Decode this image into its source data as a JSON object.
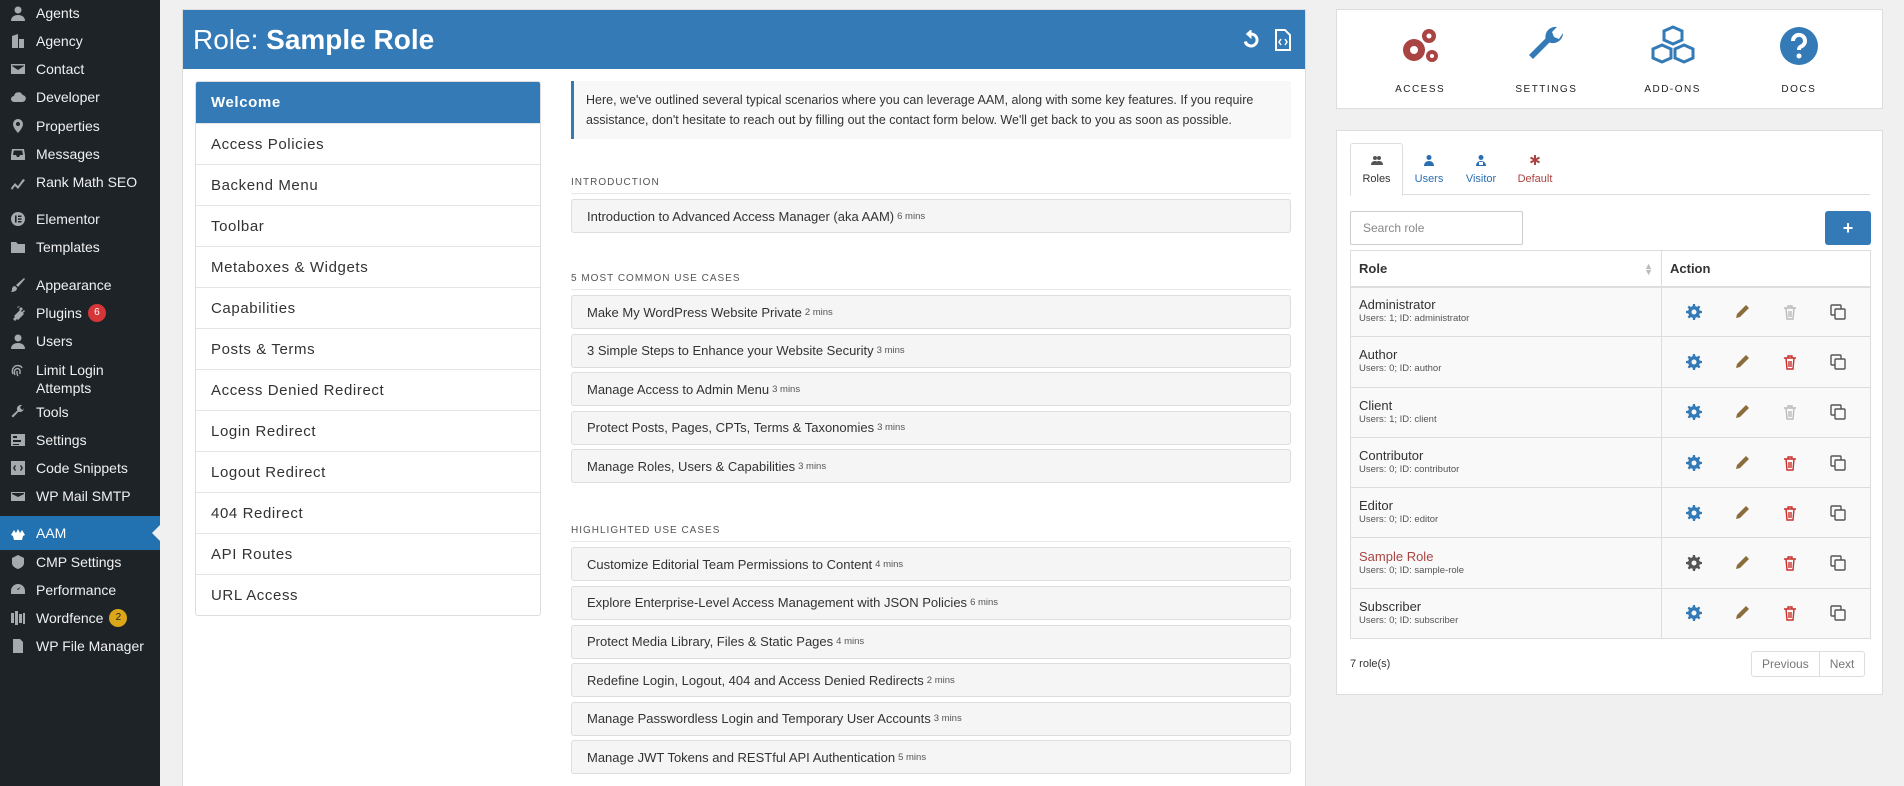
{
  "wp_menu": [
    {
      "label": "Agents",
      "icon": "user-icon"
    },
    {
      "label": "Agency",
      "icon": "building-icon"
    },
    {
      "label": "Contact",
      "icon": "mail-icon"
    },
    {
      "label": "Developer",
      "icon": "cloud-icon"
    },
    {
      "label": "Properties",
      "icon": "location-pin-icon"
    },
    {
      "label": "Messages",
      "icon": "inbox-icon"
    },
    {
      "label": "Rank Math SEO",
      "icon": "chart-icon"
    },
    {
      "label": "Elementor",
      "icon": "elementor-icon"
    },
    {
      "label": "Templates",
      "icon": "folder-icon"
    },
    {
      "label": "Appearance",
      "icon": "brush-icon"
    },
    {
      "label": "Plugins",
      "icon": "plug-icon",
      "badge": "6"
    },
    {
      "label": "Users",
      "icon": "users-icon"
    },
    {
      "label": "Limit Login Attempts",
      "icon": "fingerprint-icon"
    },
    {
      "label": "Tools",
      "icon": "wrench-icon"
    },
    {
      "label": "Settings",
      "icon": "sliders-icon"
    },
    {
      "label": "Code Snippets",
      "icon": "code-icon"
    },
    {
      "label": "WP Mail SMTP",
      "icon": "envelope-icon"
    },
    {
      "label": "AAM",
      "icon": "aam-icon",
      "active": true
    },
    {
      "label": "CMP Settings",
      "icon": "cmp-icon"
    },
    {
      "label": "Performance",
      "icon": "gauge-icon"
    },
    {
      "label": "Wordfence",
      "icon": "shield-icon",
      "badge": "2"
    },
    {
      "label": "WP File Manager",
      "icon": "file-icon"
    }
  ],
  "header": {
    "prefix": "Role:",
    "role_name": "Sample Role"
  },
  "nav": [
    "Welcome",
    "Access Policies",
    "Backend Menu",
    "Toolbar",
    "Metaboxes & Widgets",
    "Capabilities",
    "Posts & Terms",
    "Access Denied Redirect",
    "Login Redirect",
    "Logout Redirect",
    "404 Redirect",
    "API Routes",
    "URL Access"
  ],
  "intro_note": "Here, we've outlined several typical scenarios where you can leverage AAM, along with some key features. If you require assistance, don't hesitate to reach out by filling out the contact form below. We'll get back to you as soon as possible.",
  "sections": [
    {
      "title": "INTRODUCTION",
      "items": [
        {
          "label": "Introduction to Advanced Access Manager (aka AAM)",
          "mins": "6 mins"
        }
      ]
    },
    {
      "title": "5 MOST COMMON USE CASES",
      "items": [
        {
          "label": "Make My WordPress Website Private",
          "mins": "2 mins"
        },
        {
          "label": "3 Simple Steps to Enhance your Website Security",
          "mins": "3 mins"
        },
        {
          "label": "Manage Access to Admin Menu",
          "mins": "3 mins"
        },
        {
          "label": "Protect Posts, Pages, CPTs, Terms & Taxonomies",
          "mins": "3 mins"
        },
        {
          "label": "Manage Roles, Users & Capabilities",
          "mins": "3 mins"
        }
      ]
    },
    {
      "title": "HIGHLIGHTED USE CASES",
      "items": [
        {
          "label": "Customize Editorial Team Permissions to Content",
          "mins": "4 mins"
        },
        {
          "label": "Explore Enterprise-Level Access Management with JSON Policies",
          "mins": "6 mins"
        },
        {
          "label": "Protect Media Library, Files & Static Pages",
          "mins": "4 mins"
        },
        {
          "label": "Redefine Login, Logout, 404 and Access Denied Redirects",
          "mins": "2 mins"
        },
        {
          "label": "Manage Passwordless Login and Temporary User Accounts",
          "mins": "3 mins"
        },
        {
          "label": "Manage JWT Tokens and RESTful API Authentication",
          "mins": "5 mins"
        }
      ]
    }
  ],
  "tools": [
    {
      "label": "ACCESS",
      "icon": "gears-icon",
      "color": "#a94442"
    },
    {
      "label": "SETTINGS",
      "icon": "wrench-icon",
      "color": "#337ab7"
    },
    {
      "label": "ADD-ONS",
      "icon": "cubes-icon",
      "color": "#337ab7"
    },
    {
      "label": "DOCS",
      "icon": "question-icon",
      "color": "#337ab7"
    }
  ],
  "subject_tabs": [
    {
      "label": "Roles",
      "icon": "users-icon",
      "active": true
    },
    {
      "label": "Users",
      "icon": "user-icon"
    },
    {
      "label": "Visitor",
      "icon": "visitor-icon"
    },
    {
      "label": "Default",
      "icon": "asterisk-icon"
    }
  ],
  "search": {
    "placeholder": "Search role"
  },
  "add_label": "+",
  "table": {
    "col_role": "Role",
    "col_action": "Action"
  },
  "roles": [
    {
      "name": "Administrator",
      "meta": "Users: 1; ID: administrator"
    },
    {
      "name": "Author",
      "meta": "Users: 0; ID: author"
    },
    {
      "name": "Client",
      "meta": "Users: 1; ID: client"
    },
    {
      "name": "Contributor",
      "meta": "Users: 0; ID: contributor"
    },
    {
      "name": "Editor",
      "meta": "Users: 0; ID: editor"
    },
    {
      "name": "Sample Role",
      "meta": "Users: 0; ID: sample-role",
      "current": true
    },
    {
      "name": "Subscriber",
      "meta": "Users: 0; ID: subscriber"
    }
  ],
  "count_text": "7 role(s)",
  "pager": {
    "prev": "Previous",
    "next": "Next"
  },
  "colors": {
    "accent": "#337ab7",
    "danger": "#a94442",
    "wp_sidebar": "#1d2327",
    "wp_active": "#2271b1"
  }
}
